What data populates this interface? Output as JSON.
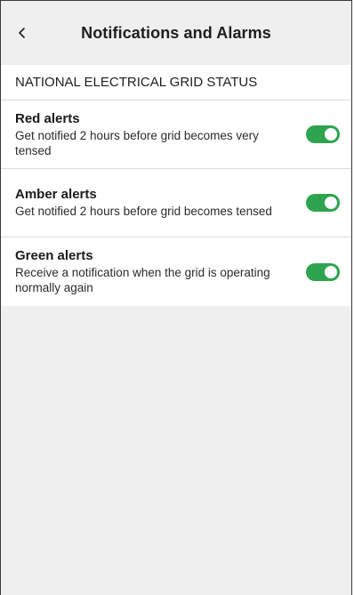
{
  "header": {
    "title": "Notifications and Alarms",
    "back_icon": "chevron-left-icon"
  },
  "section": {
    "title": "NATIONAL ELECTRICAL GRID STATUS"
  },
  "colors": {
    "toggle_on": "#2ea44f",
    "background": "#efeff0"
  },
  "alerts": [
    {
      "title": "Red alerts",
      "description": "Get notified 2 hours before grid becomes very tensed",
      "enabled": true
    },
    {
      "title": "Amber alerts",
      "description": "Get notified 2 hours before grid becomes tensed",
      "enabled": true
    },
    {
      "title": "Green alerts",
      "description": "Receive a notification when the grid is operating normally again",
      "enabled": true
    }
  ]
}
